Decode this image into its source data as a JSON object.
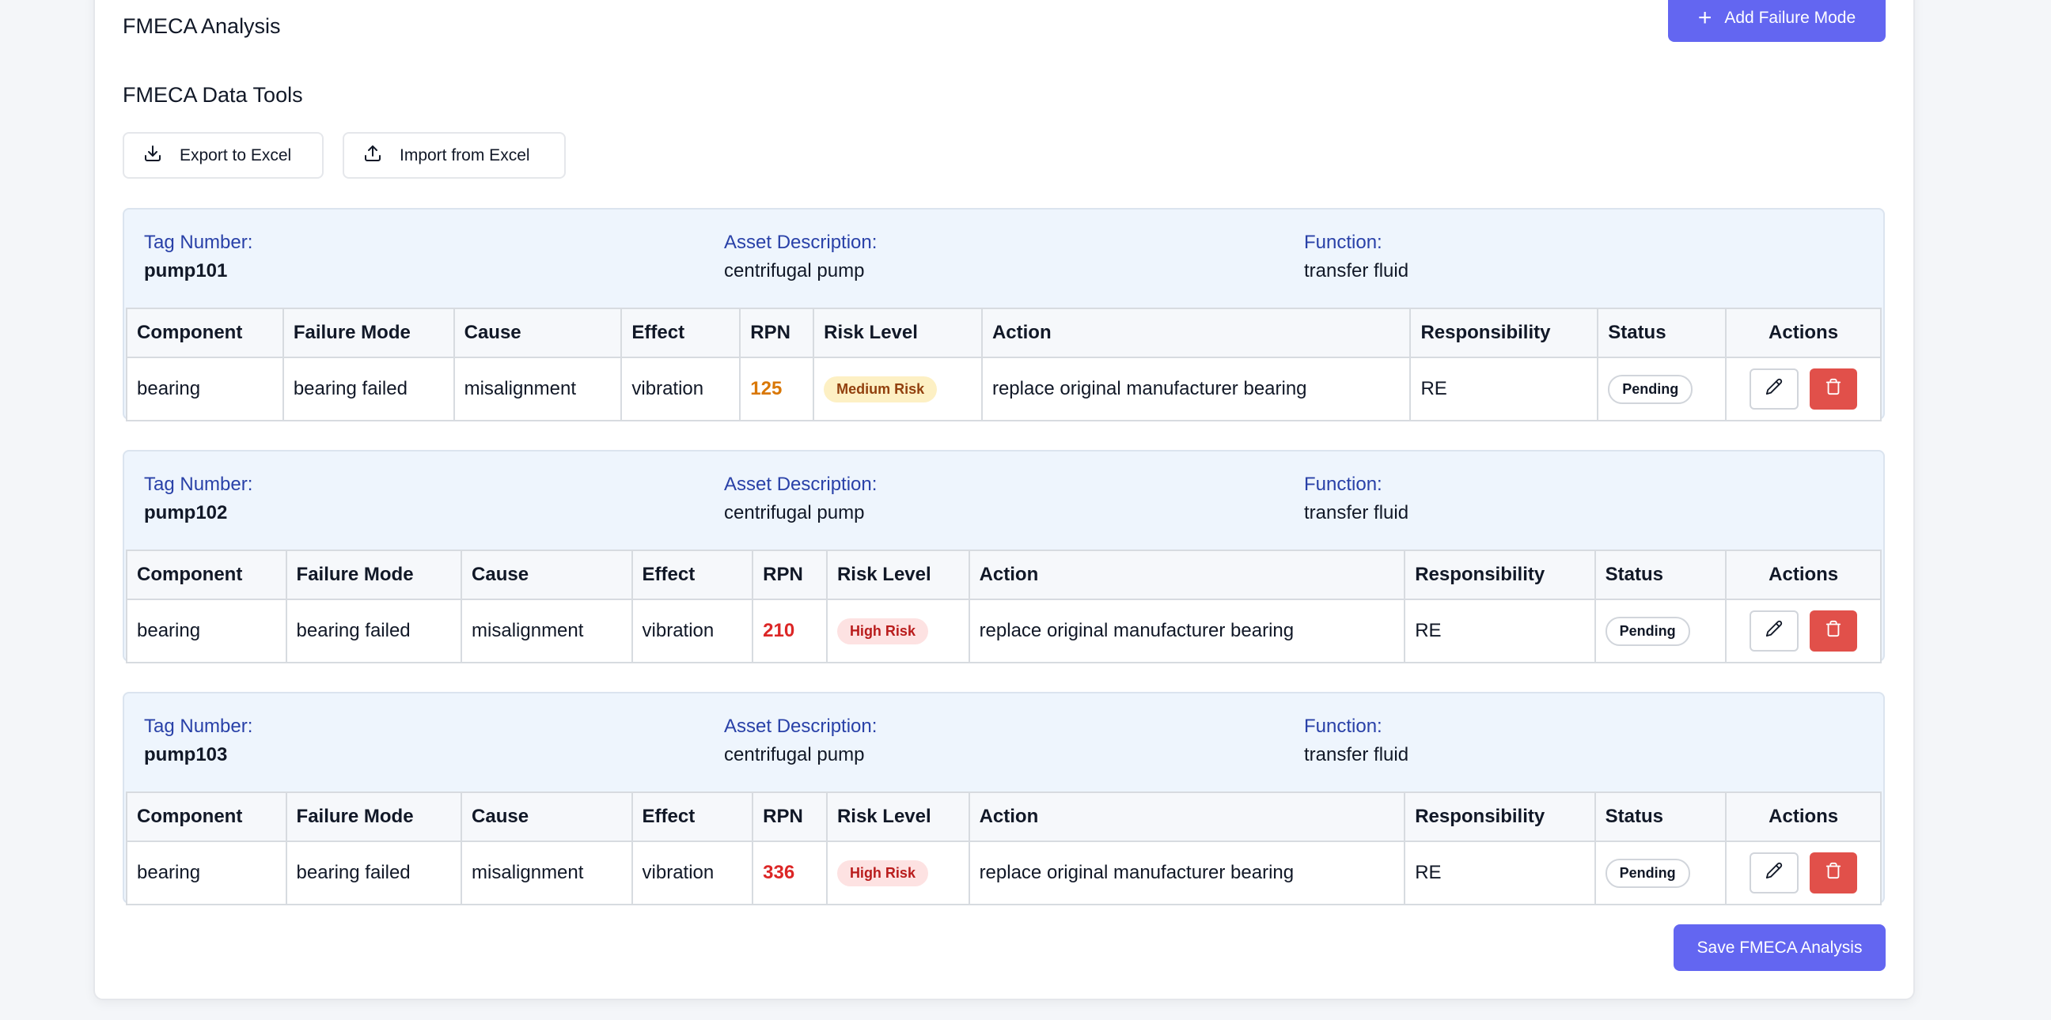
{
  "page": {
    "title": "FMECA Analysis",
    "add_button": "Add Failure Mode",
    "tools_title": "FMECA Data Tools",
    "export_button": "Export to Excel",
    "import_button": "Import from Excel",
    "save_button": "Save FMECA Analysis"
  },
  "labels": {
    "tag": "Tag Number:",
    "asset_description": "Asset Description:",
    "function": "Function:"
  },
  "columns": [
    "Component",
    "Failure Mode",
    "Cause",
    "Effect",
    "RPN",
    "Risk Level",
    "Action",
    "Responsibility",
    "Status",
    "Actions"
  ],
  "colors": {
    "primary": "#6366f1",
    "medium_rpn": "#d97706",
    "high_rpn": "#dc2626",
    "medium_pill_bg": "#fdf0c4",
    "medium_pill_text": "#92400e",
    "high_pill_bg": "#fde2e2",
    "high_pill_text": "#b91c1c",
    "delete": "#e1504a"
  },
  "assets": [
    {
      "tag": "pump101",
      "description": "centrifugal pump",
      "function": "transfer fluid",
      "rows": [
        {
          "component": "bearing",
          "failure_mode": "bearing failed",
          "cause": "misalignment",
          "effect": "vibration",
          "rpn": "125",
          "risk_level": "Medium Risk",
          "action": "replace original manufacturer bearing",
          "responsibility": "RE",
          "status": "Pending"
        }
      ]
    },
    {
      "tag": "pump102",
      "description": "centrifugal pump",
      "function": "transfer fluid",
      "rows": [
        {
          "component": "bearing",
          "failure_mode": "bearing failed",
          "cause": "misalignment",
          "effect": "vibration",
          "rpn": "210",
          "risk_level": "High Risk",
          "action": "replace original manufacturer bearing",
          "responsibility": "RE",
          "status": "Pending"
        }
      ]
    },
    {
      "tag": "pump103",
      "description": "centrifugal pump",
      "function": "transfer fluid",
      "rows": [
        {
          "component": "bearing",
          "failure_mode": "bearing failed",
          "cause": "misalignment",
          "effect": "vibration",
          "rpn": "336",
          "risk_level": "High Risk",
          "action": "replace original manufacturer bearing",
          "responsibility": "RE",
          "status": "Pending"
        }
      ]
    }
  ]
}
